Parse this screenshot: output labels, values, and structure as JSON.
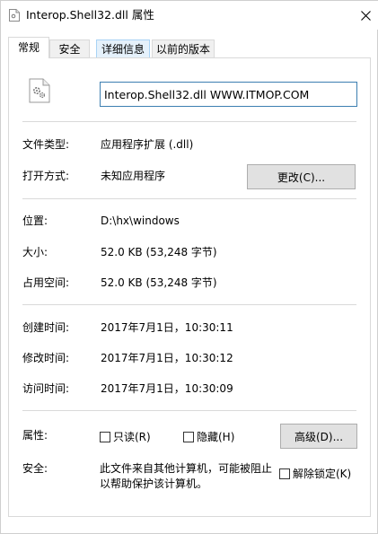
{
  "window": {
    "title": "Interop.Shell32.dll 属性"
  },
  "tabs": [
    {
      "label": "常规"
    },
    {
      "label": "安全"
    },
    {
      "label": "详细信息"
    },
    {
      "label": "以前的版本"
    }
  ],
  "general": {
    "filename": "Interop.Shell32.dll WWW.ITMOP.COM",
    "type_label": "文件类型:",
    "type_value": "应用程序扩展 (.dll)",
    "opens_label": "打开方式:",
    "opens_value": "未知应用程序",
    "change_button": "更改(C)...",
    "location_label": "位置:",
    "location_value": "D:\\hx\\windows",
    "size_label": "大小:",
    "size_value": "52.0 KB (53,248 字节)",
    "disk_label": "占用空间:",
    "disk_value": "52.0 KB (53,248 字节)",
    "created_label": "创建时间:",
    "created_value": "2017年7月1日，10:30:11",
    "modified_label": "修改时间:",
    "modified_value": "2017年7月1日，10:30:12",
    "accessed_label": "访问时间:",
    "accessed_value": "2017年7月1日，10:30:09",
    "attributes_label": "属性:",
    "readonly_label": "只读(R)",
    "hidden_label": "隐藏(H)",
    "advanced_button": "高级(D)...",
    "security_label": "安全:",
    "security_line1": "此文件来自其他计算机，可能被阻止",
    "security_line2": "以帮助保护该计算机。",
    "unblock_label": "解除锁定(K)"
  }
}
